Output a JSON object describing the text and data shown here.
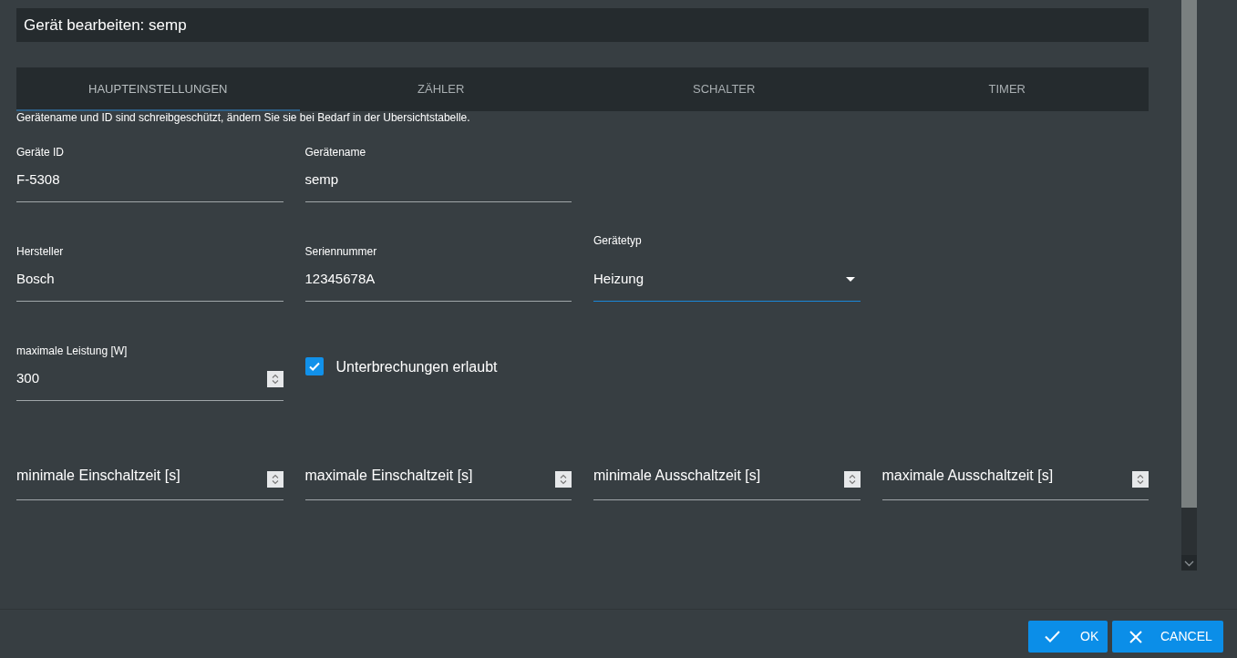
{
  "dialog_title": "Gerät bearbeiten: semp",
  "tabs": [
    {
      "label": "HAUPTEINSTELLUNGEN",
      "selected": true
    },
    {
      "label": "ZÄHLER",
      "selected": false
    },
    {
      "label": "SCHALTER",
      "selected": false
    },
    {
      "label": "TIMER",
      "selected": false
    }
  ],
  "notice": "Gerätename und ID sind schreibgeschützt, ändern Sie sie bei Bedarf in der Ubersichtstabelle.",
  "rows": [
    [
      {
        "kind": "text",
        "label": "Geräte ID",
        "value": "F-5308"
      },
      {
        "kind": "text",
        "label": "Gerätename",
        "value": "semp"
      }
    ],
    [
      {
        "kind": "text",
        "label": "Hersteller",
        "value": "Bosch"
      },
      {
        "kind": "text",
        "label": "Seriennummer",
        "value": "12345678A"
      },
      {
        "kind": "select",
        "label": "Gerätetyp",
        "value": "Heizung",
        "focused": true
      }
    ],
    [
      {
        "kind": "number",
        "label": "maximale Leistung [W]",
        "value": "300"
      },
      {
        "kind": "checkbox",
        "label": "Unterbrechungen erlaubt",
        "checked": true
      }
    ],
    [
      {
        "kind": "number",
        "placeholder": "minimale Einschaltzeit [s]"
      },
      {
        "kind": "number",
        "placeholder": "maximale Einschaltzeit [s]"
      },
      {
        "kind": "number",
        "placeholder": "minimale Ausschaltzeit [s]"
      },
      {
        "kind": "number",
        "placeholder": "maximale Ausschaltzeit [s]"
      }
    ]
  ],
  "buttons": [
    {
      "kind": "ok",
      "label": "OK"
    },
    {
      "kind": "cancel",
      "label": "CANCEL"
    }
  ]
}
